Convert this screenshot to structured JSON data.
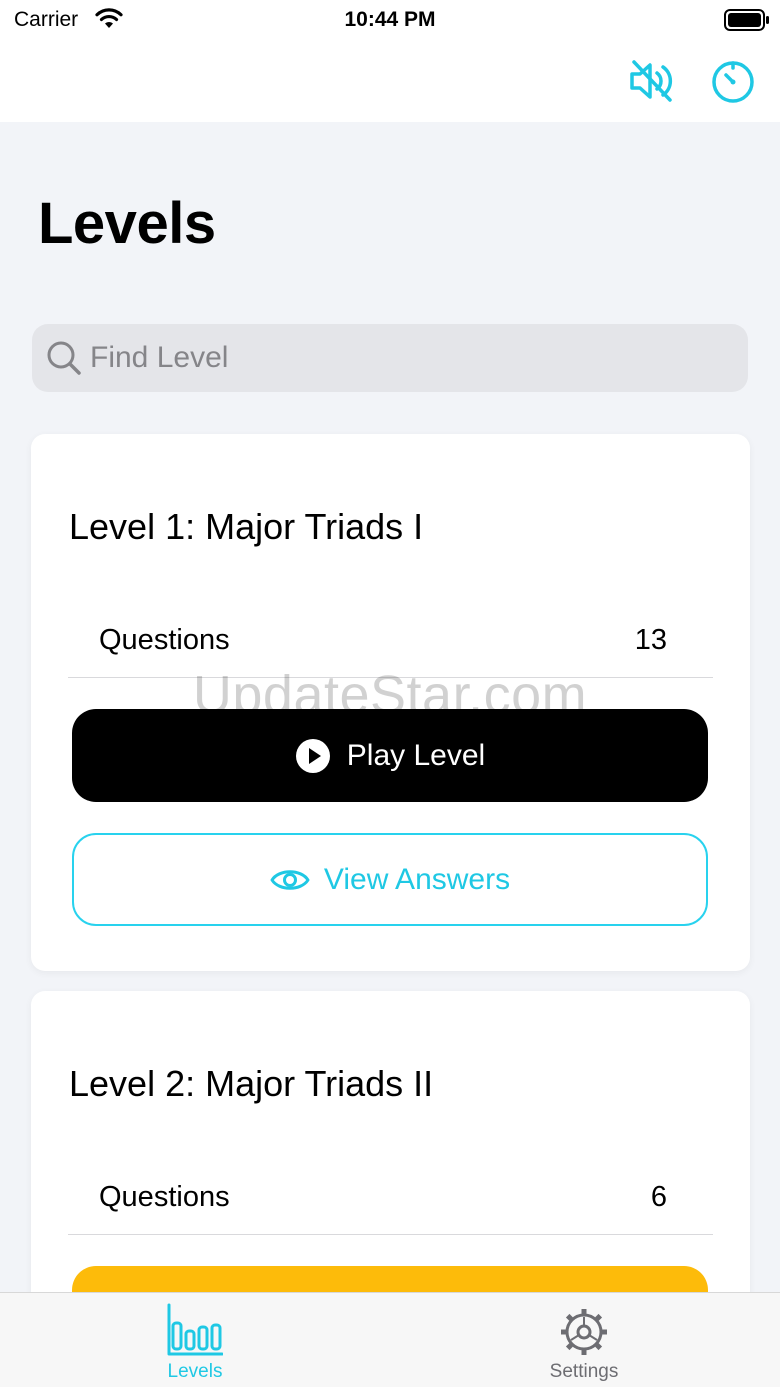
{
  "status_bar": {
    "carrier": "Carrier",
    "time": "10:44 PM"
  },
  "nav": {
    "mute_icon": "speaker-muted-icon",
    "timer_icon": "timer-icon"
  },
  "page_title": "Levels",
  "search": {
    "placeholder": "Find Level",
    "value": ""
  },
  "levels": [
    {
      "title": "Level 1: Major Triads I",
      "stat_label": "Questions",
      "stat_value": "13",
      "play_label": "Play Level",
      "view_label": "View Answers"
    },
    {
      "title": "Level 2: Major Triads II",
      "stat_label": "Questions",
      "stat_value": "6"
    }
  ],
  "tabs": [
    {
      "label": "Levels",
      "icon": "bar-chart-icon",
      "selected": true
    },
    {
      "label": "Settings",
      "icon": "gear-icon",
      "selected": false
    }
  ],
  "watermark": "UpdateStar.com",
  "colors": {
    "accent": "#1FC8E4",
    "play_button": "#000000",
    "level2_button": "#FDBB0A",
    "background": "#F2F4F8"
  }
}
